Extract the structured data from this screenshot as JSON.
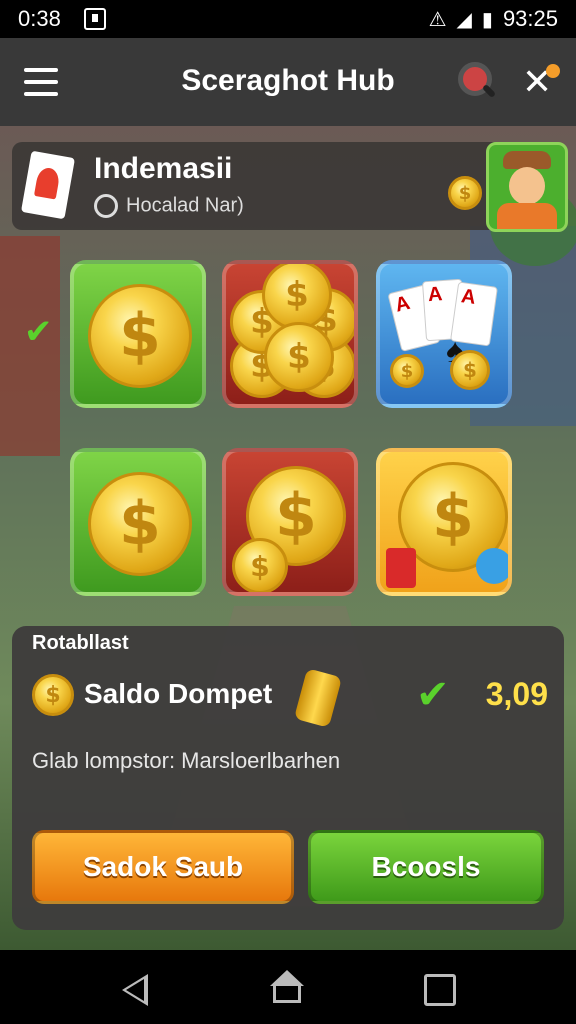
{
  "status_bar": {
    "time": "0:38",
    "clock": "93:25"
  },
  "app_bar": {
    "title": "Sceraghot Hub"
  },
  "profile": {
    "name": "Indemasii",
    "subtitle": "Hocalad Nar)"
  },
  "coin_symbol": "$",
  "tiles": [
    {
      "id": "tile-1",
      "color": "#4aa82a",
      "content": "coin"
    },
    {
      "id": "tile-2",
      "color": "#b53227",
      "content": "coin-pile"
    },
    {
      "id": "tile-3",
      "color": "#3f8fd8",
      "content": "playing-cards"
    },
    {
      "id": "tile-4",
      "color": "#4aa82a",
      "content": "coin"
    },
    {
      "id": "tile-5",
      "color": "#a52a22",
      "content": "coins"
    },
    {
      "id": "tile-6",
      "color": "#f5b428",
      "content": "coin-with-items"
    }
  ],
  "cards": {
    "card1": "A",
    "card2": "A",
    "card3": "A"
  },
  "wallet": {
    "section_title": "Rotabllast",
    "label": "Saldo Dompet",
    "amount": "3,09",
    "note": "Glab lompstor: Marsloerlbarhen"
  },
  "buttons": {
    "primary": "Sadok Saub",
    "secondary": "Bcoosls"
  },
  "colors": {
    "accent_orange": "#f49d2a",
    "accent_green": "#4aa82a",
    "amount_yellow": "#ffe04a"
  }
}
